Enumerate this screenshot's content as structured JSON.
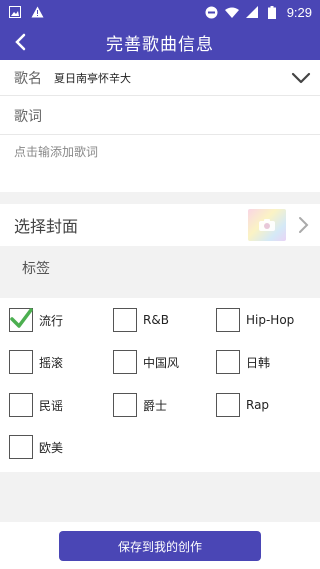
{
  "status_bar": {
    "time": "9:29",
    "left_icons": [
      "image-icon",
      "warning-icon"
    ],
    "right_icons": [
      "stop-icon",
      "wifi-icon",
      "signal-icon",
      "battery-icon"
    ]
  },
  "app_bar": {
    "title": "完善歌曲信息",
    "back_icon": "back-arrow-icon"
  },
  "song_name": {
    "label": "歌名",
    "value": "夏日南亭怀辛大"
  },
  "lyrics": {
    "label": "歌词",
    "placeholder": "点击输添加歌词"
  },
  "cover": {
    "label": "选择封面"
  },
  "tags": {
    "label": "标签",
    "items": [
      {
        "label": "流行",
        "checked": true
      },
      {
        "label": "R&B",
        "checked": false
      },
      {
        "label": "Hip-Hop",
        "checked": false
      },
      {
        "label": "摇滚",
        "checked": false
      },
      {
        "label": "中国风",
        "checked": false
      },
      {
        "label": "日韩",
        "checked": false
      },
      {
        "label": "民谣",
        "checked": false
      },
      {
        "label": "爵士",
        "checked": false
      },
      {
        "label": "Rap",
        "checked": false
      },
      {
        "label": "欧美",
        "checked": false
      }
    ]
  },
  "footer": {
    "save_label": "保存到我的创作"
  },
  "colors": {
    "primary": "#4a46b5",
    "check": "#4caf50"
  }
}
